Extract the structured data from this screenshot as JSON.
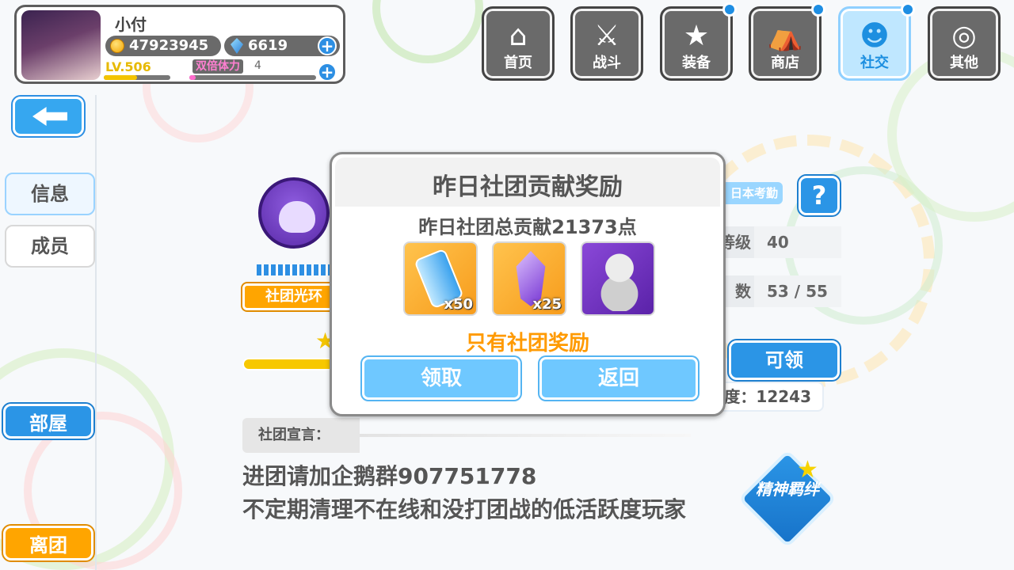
{
  "player": {
    "name": "小付",
    "gold": "47923945",
    "gems": "6619",
    "level": "LV.506",
    "level_progress": 0.5,
    "stamina_label": "双倍体力",
    "stamina_value": "4",
    "stamina_progress": 0.05
  },
  "nav": [
    {
      "label": "首页",
      "icon": "home-icon",
      "glyph": "⌂",
      "badge": false,
      "active": false
    },
    {
      "label": "战斗",
      "icon": "swords-icon",
      "glyph": "⚔",
      "badge": false,
      "active": false
    },
    {
      "label": "装备",
      "icon": "star-gun-icon",
      "glyph": "★",
      "badge": true,
      "active": false
    },
    {
      "label": "商店",
      "icon": "shop-basket-icon",
      "glyph": "⛺",
      "badge": true,
      "active": false
    },
    {
      "label": "社交",
      "icon": "social-mascot-icon",
      "glyph": "☻",
      "badge": true,
      "active": true
    },
    {
      "label": "其他",
      "icon": "snail-icon",
      "glyph": "◎",
      "badge": false,
      "active": false
    }
  ],
  "side": {
    "tab_info": "信息",
    "tab_members": "成员",
    "room": "部屋",
    "leave": "离团"
  },
  "guild": {
    "aura": "社团光环",
    "attendance_tag": "日本考勤",
    "help": "?",
    "level_label": "等级",
    "level_value": "40",
    "members_label": "数",
    "members_value": "53 / 55",
    "claim": "可领",
    "activity": "度：12243",
    "declaration_label": "社团宣言：",
    "declaration_line1": "进团请加企鹅群907751778",
    "declaration_line2": "不定期清理不在线和没打团战的低活跃度玩家",
    "spirit_badge": "精神羁绊"
  },
  "modal": {
    "title": "昨日社团贡献奖励",
    "subtitle": "昨日社团总贡献21373点",
    "rewards": [
      {
        "name": "blue-potion-item",
        "qty": "x50"
      },
      {
        "name": "purple-crystal-item",
        "qty": "x25"
      },
      {
        "name": "bear-statue-item",
        "qty": ""
      }
    ],
    "note": "只有社团奖励",
    "receive": "领取",
    "return": "返回"
  }
}
